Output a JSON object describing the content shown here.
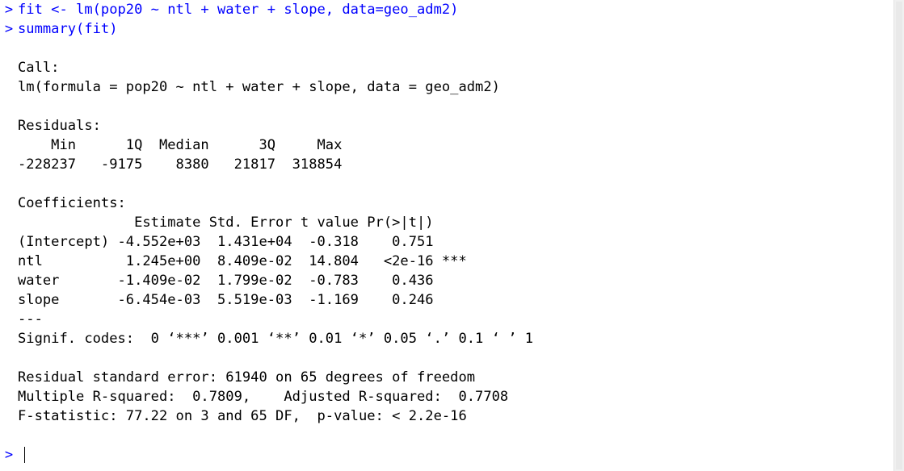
{
  "console": {
    "prompt_symbol": ">",
    "commands": [
      "fit <- lm(pop20 ~ ntl + water + slope, data=geo_adm2)",
      "summary(fit)"
    ],
    "output": {
      "call_header": "Call:",
      "call_formula": "lm(formula = pop20 ~ ntl + water + slope, data = geo_adm2)",
      "residuals_header": "Residuals:",
      "residuals_labels_row": "    Min      1Q  Median      3Q     Max ",
      "residuals_values_row": "-228237   -9175    8380   21817  318854 ",
      "coefficients_header": "Coefficients:",
      "coef_header_row": "              Estimate Std. Error t value Pr(>|t|)    ",
      "coef_rows": [
        "(Intercept) -4.552e+03  1.431e+04  -0.318    0.751    ",
        "ntl          1.245e+00  8.409e-02  14.804   <2e-16 ***",
        "water       -1.409e-02  1.799e-02  -0.783    0.436    ",
        "slope       -6.454e-03  5.519e-03  -1.169    0.246    "
      ],
      "separator": "---",
      "signif_codes": "Signif. codes:  0 ‘***’ 0.001 ‘**’ 0.01 ‘*’ 0.05 ‘.’ 0.1 ‘ ’ 1",
      "residual_se": "Residual standard error: 61940 on 65 degrees of freedom",
      "r_squared": "Multiple R-squared:  0.7809,\tAdjusted R-squared:  0.7708 ",
      "f_statistic": "F-statistic: 77.22 on 3 and 65 DF,  p-value: < 2.2e-16"
    },
    "colors": {
      "input_text": "#0000ff",
      "output_text": "#000000",
      "background": "#ffffff"
    }
  }
}
